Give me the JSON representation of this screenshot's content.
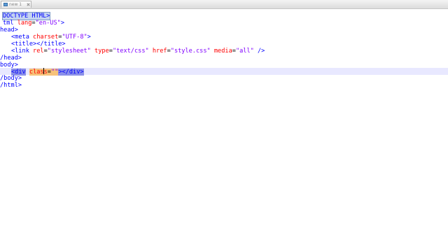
{
  "tab": {
    "label": "new  1",
    "icon": "file-icon",
    "close_icon": "close-icon"
  },
  "code": {
    "line1": "DOCTYPE HTML>",
    "line2_start": "tml ",
    "line2_attr": "lang",
    "line2_eq": "=",
    "line2_val": "\"en-US\"",
    "line2_end": ">",
    "line3": "head>",
    "line4_tag": "<meta ",
    "line4_attr": "charset",
    "line4_eq": "=",
    "line4_val": "\"UTF-8\"",
    "line4_end": ">",
    "line5": "<title></title>",
    "line6_tag": "<link ",
    "line6_attr1": "rel",
    "line6_val1": "\"stylesheet\"",
    "line6_attr2": "type",
    "line6_val2": "\"text/css\"",
    "line6_attr3": "href",
    "line6_val3": "\"style.css\"",
    "line6_attr4": "media",
    "line6_val4": "\"all\"",
    "line6_end": "/>",
    "line7": "/head>",
    "line8": "body>",
    "line9_tag": "<div",
    "line9_attr_a": "clas",
    "line9_attr_b": "s",
    "line9_eq": "=",
    "line9_val": "\"\"",
    "line9_end": "></div>",
    "line10": "/body>",
    "line11": "/html>"
  },
  "colors": {
    "tag": "#0000ff",
    "attribute": "#ff0000",
    "value": "#8000ff",
    "current_line": "#e8e8ff",
    "tag_match_highlight": "#8a8fe8"
  }
}
